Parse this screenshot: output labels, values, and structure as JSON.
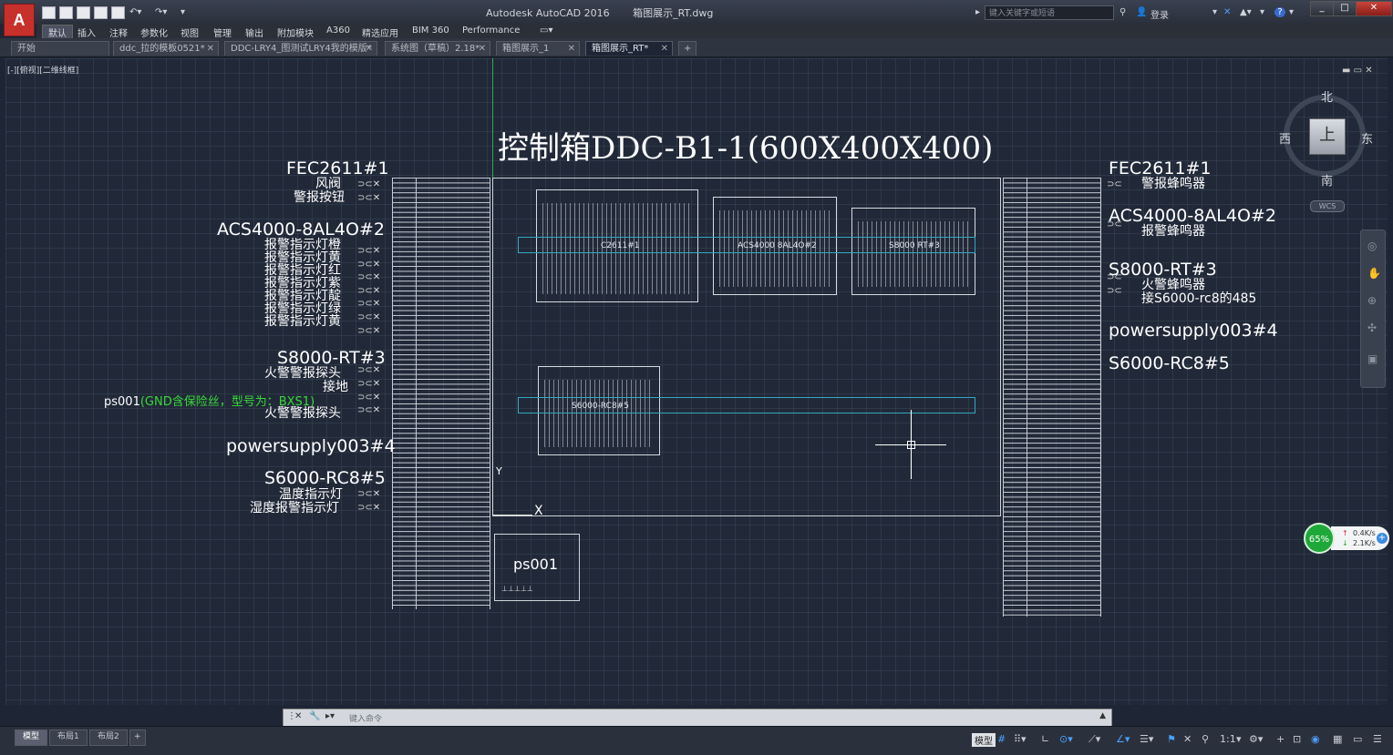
{
  "titlebar": {
    "app_name": "Autodesk AutoCAD 2016",
    "file_name": "箱图展示_RT.dwg",
    "search_placeholder": "键入关键字或短语",
    "user": "登录",
    "help": "?"
  },
  "ribbon_tabs": [
    "默认",
    "插入",
    "注释",
    "参数化",
    "视图",
    "管理",
    "输出",
    "附加模块",
    "A360",
    "精选应用",
    "BIM 360",
    "Performance"
  ],
  "doc_tabs": [
    {
      "label": "开始"
    },
    {
      "label": "ddc_拉的模板0521*"
    },
    {
      "label": "DDC-LRY4_图测试LRY4我的模版*"
    },
    {
      "label": "系统图（草稿）2.18*"
    },
    {
      "label": "箱图展示_1"
    },
    {
      "label": "箱图展示_RT*"
    }
  ],
  "viewport_label": "[-][俯视][二维线框]",
  "drawing": {
    "main_title": "控制箱DDC-B1-1(600X400X400)",
    "left_labels": {
      "fec": {
        "title": "FEC2611#1",
        "items": [
          "风阀",
          "警报按钮"
        ]
      },
      "acs": {
        "title": "ACS4000-8AL4O#2",
        "items": [
          "报警指示灯橙",
          "报警指示灯黄",
          "报警指示灯红",
          "报警指示灯紫",
          "报警指示灯靛",
          "报警指示灯绿",
          "报警指示灯黄"
        ]
      },
      "s8000": {
        "title": "S8000-RT#3",
        "items": [
          "火警警报探头",
          "接地"
        ]
      },
      "ps_note_prefix": "ps001",
      "ps_note": "(GND含保险丝，型号为：BXS1)",
      "s8000_extra": "火警警报探头",
      "powersupply": "powersupply003#4",
      "s6000": {
        "title": "S6000-RC8#5",
        "items": [
          "温度指示灯",
          "湿度报警指示灯"
        ]
      }
    },
    "right_labels": {
      "fec": {
        "title": "FEC2611#1",
        "items": [
          "警报蜂鸣器"
        ]
      },
      "acs": {
        "title": "ACS4000-8AL4O#2",
        "items": [
          "报警蜂鸣器"
        ]
      },
      "s8000": {
        "title": "S8000-RT#3",
        "items": [
          "火警蜂鸣器",
          "接S6000-rc8的485"
        ]
      },
      "powersupply": "powersupply003#4",
      "s6000": "S6000-RC8#5"
    },
    "chips": [
      "C2611#1",
      "ACS4000 8AL4O#2",
      "S8000 RT#3",
      "S6000-RC8#5"
    ],
    "ps_box": "ps001",
    "axis_y": "Y",
    "axis_x": "X"
  },
  "viewcube": {
    "north": "北",
    "south": "南",
    "east": "东",
    "west": "西",
    "top": "上",
    "wcs": "WCS"
  },
  "net_widget": {
    "percent": "65%",
    "up": "0.4K/s",
    "down": "2.1K/s"
  },
  "command_line": {
    "placeholder": "键入命令"
  },
  "layout_tabs": [
    {
      "label": "模型"
    },
    {
      "label": "布局1"
    },
    {
      "label": "布局2"
    }
  ],
  "status": {
    "model_toggle": "模型",
    "scale": "1:1"
  }
}
